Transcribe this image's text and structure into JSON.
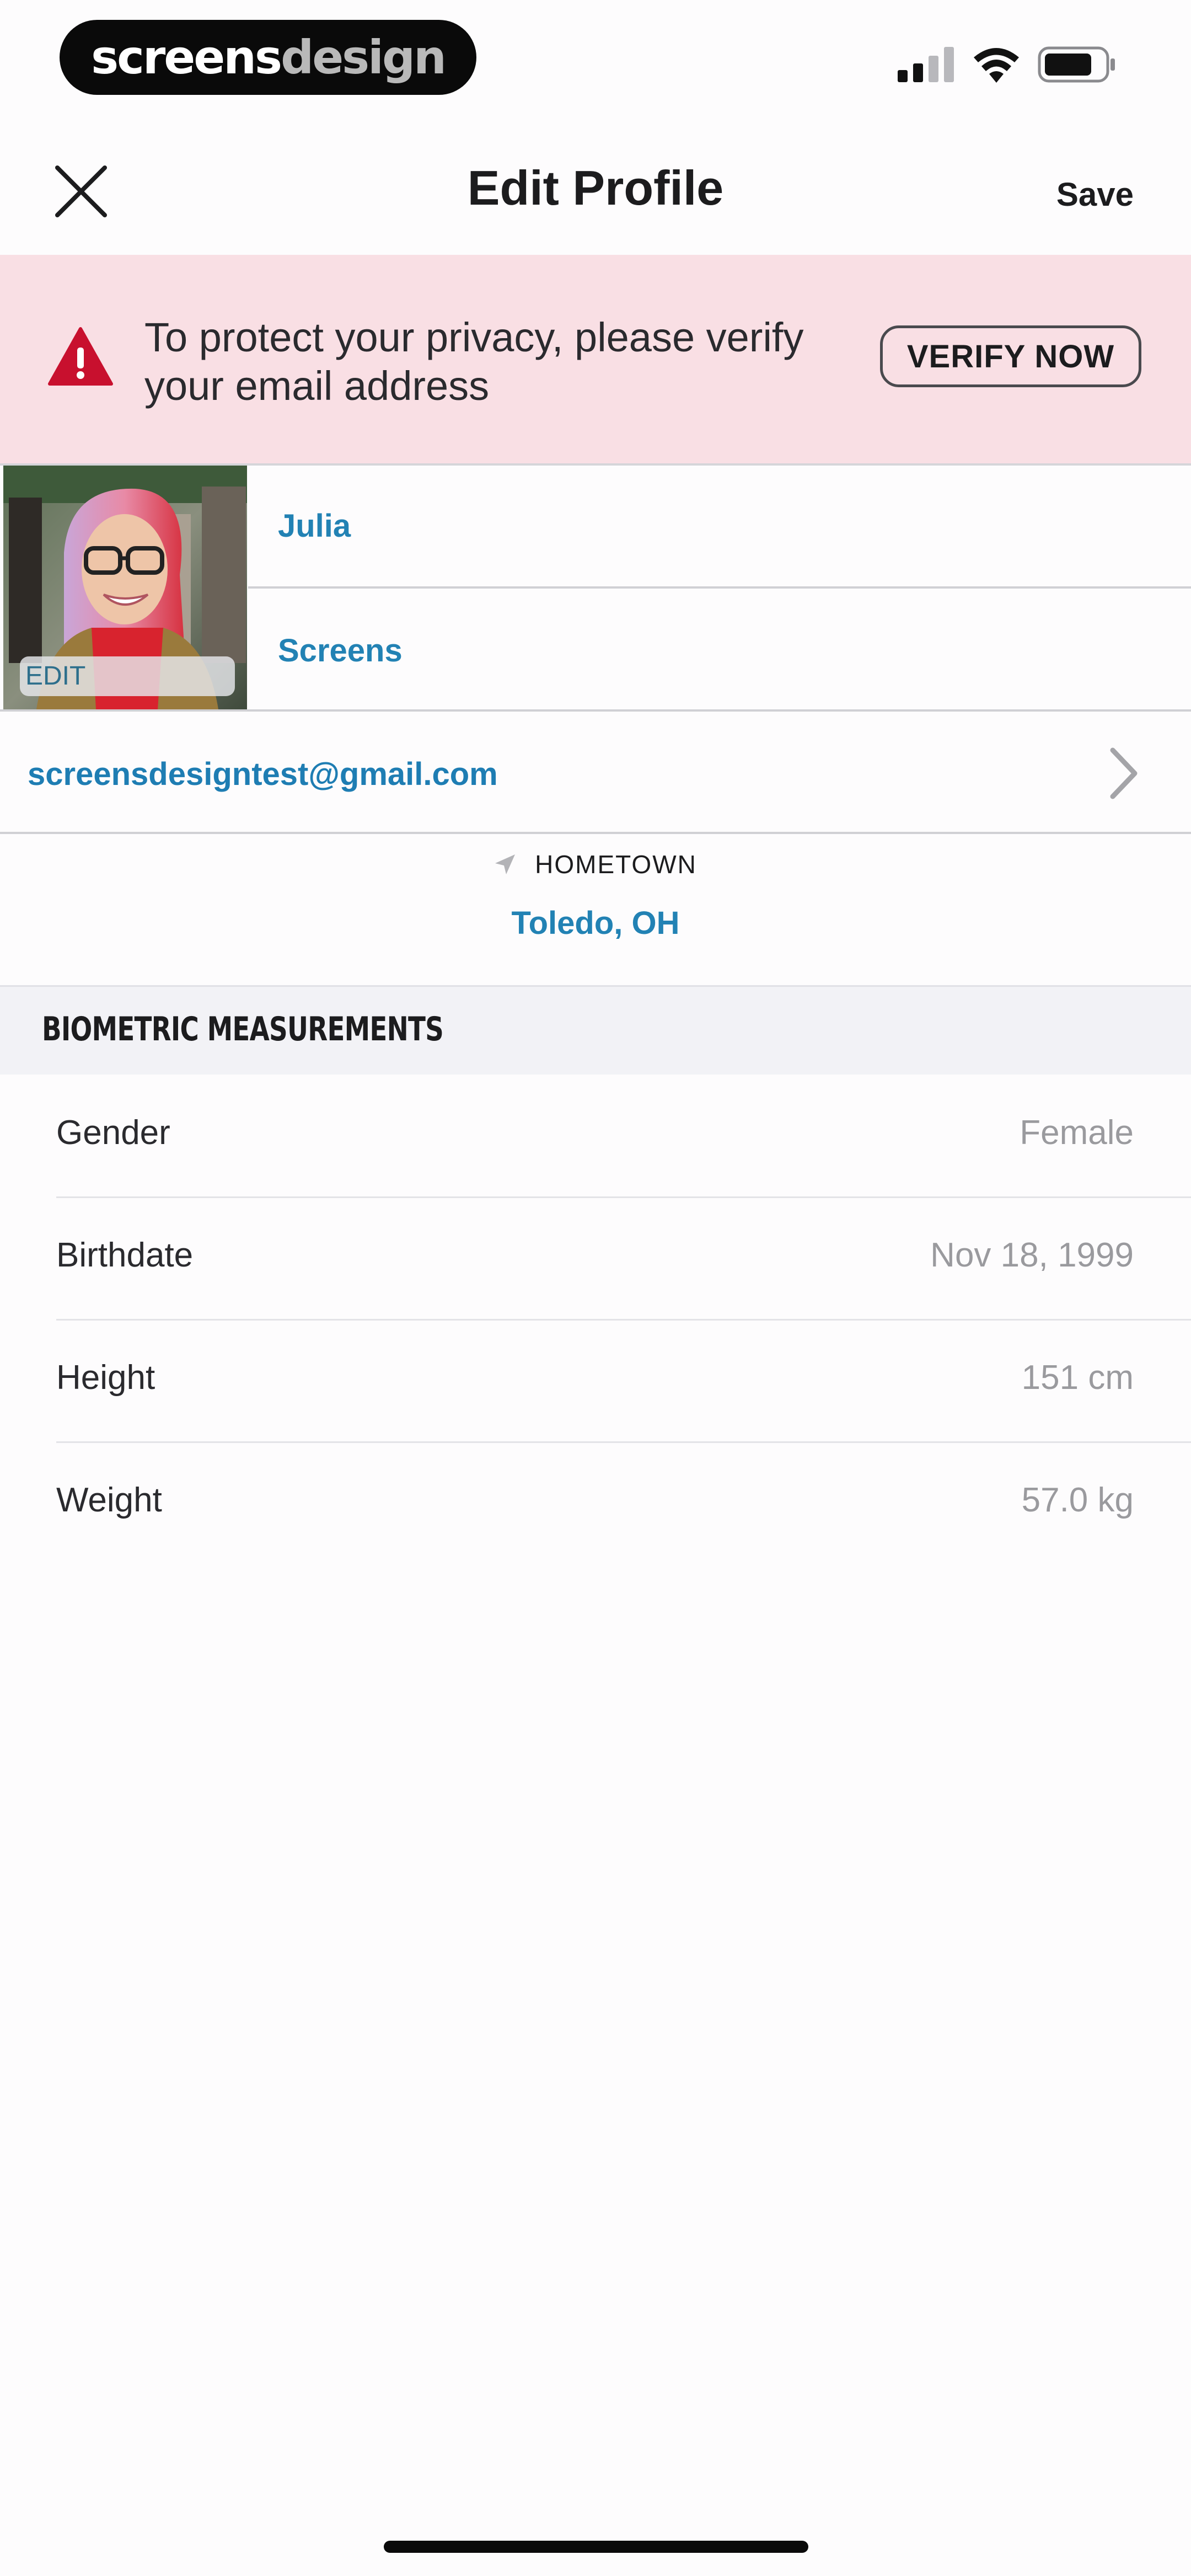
{
  "status_bar": {
    "brand_part1": "screens",
    "brand_part2": "design",
    "signal_icon": "cellular-signal-icon",
    "wifi_icon": "wifi-icon",
    "battery_icon": "battery-icon"
  },
  "nav": {
    "title": "Edit Profile",
    "save_label": "Save",
    "close_icon": "close-icon"
  },
  "banner": {
    "message": "To protect your privacy, please verify your email address",
    "button_label": "VERIFY NOW",
    "icon": "warning-triangle-icon",
    "background_color": "#f9dfe4",
    "icon_color": "#c8102e"
  },
  "profile": {
    "photo_edit_label": "EDIT",
    "first_name": "Julia",
    "last_name": "Screens",
    "email": "screensdesigntest@gmail.com"
  },
  "hometown": {
    "label": "HOMETOWN",
    "value": "Toledo, OH",
    "icon": "location-arrow-icon"
  },
  "biometrics": {
    "section_title": "BIOMETRIC MEASUREMENTS",
    "rows": [
      {
        "label": "Gender",
        "value": "Female"
      },
      {
        "label": "Birthdate",
        "value": "Nov 18, 1999"
      },
      {
        "label": "Height",
        "value": "151 cm"
      },
      {
        "label": "Weight",
        "value": "57.0 kg"
      }
    ]
  },
  "colors": {
    "link_blue": "#2282b4",
    "value_gray": "#9a9a9e"
  }
}
